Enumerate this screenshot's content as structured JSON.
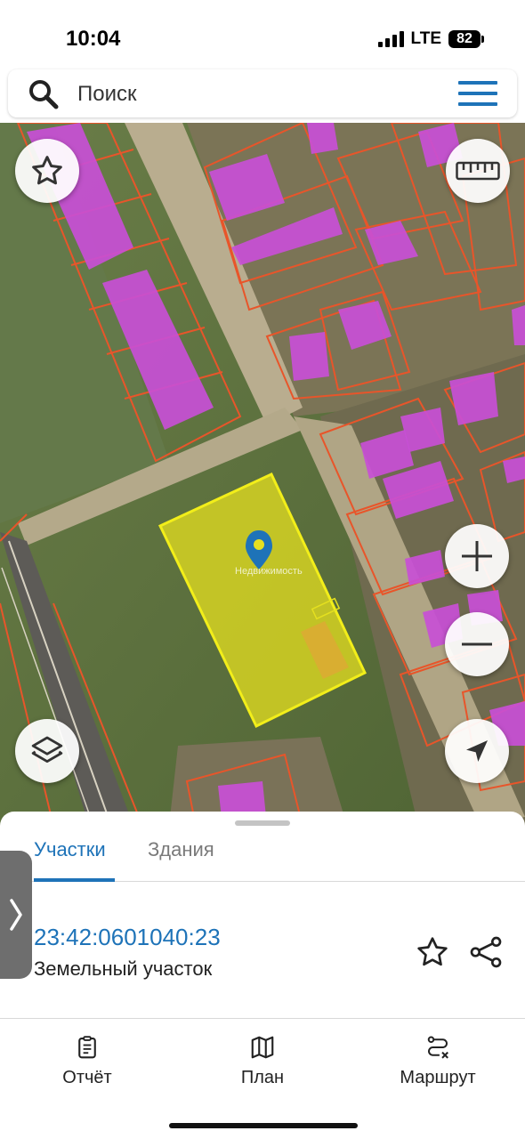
{
  "status_bar": {
    "time": "10:04",
    "network": "LTE",
    "battery": "82"
  },
  "search": {
    "placeholder": "Поиск"
  },
  "map": {
    "watermark": "Недвижимость",
    "colors": {
      "parcel_border": "#e8552a",
      "building": "#c84fd6",
      "selected_parcel": "#e5e01f"
    }
  },
  "map_controls": {
    "favorite_icon": "star-icon",
    "ruler_icon": "ruler-icon",
    "layers_icon": "layers-icon",
    "zoom_in_icon": "plus-icon",
    "zoom_out_icon": "minus-icon",
    "locate_icon": "navigation-arrow-icon"
  },
  "sheet": {
    "tabs": [
      {
        "label": "Участки",
        "active": true
      },
      {
        "label": "Здания",
        "active": false
      }
    ],
    "parcel": {
      "number": "23:42:0601040:23",
      "type": "Земельный участок"
    }
  },
  "bottom_nav": {
    "items": [
      {
        "label": "Отчёт",
        "icon": "clipboard-icon"
      },
      {
        "label": "План",
        "icon": "map-icon"
      },
      {
        "label": "Маршрут",
        "icon": "route-icon"
      }
    ]
  },
  "accent_color": "#1e73b8"
}
